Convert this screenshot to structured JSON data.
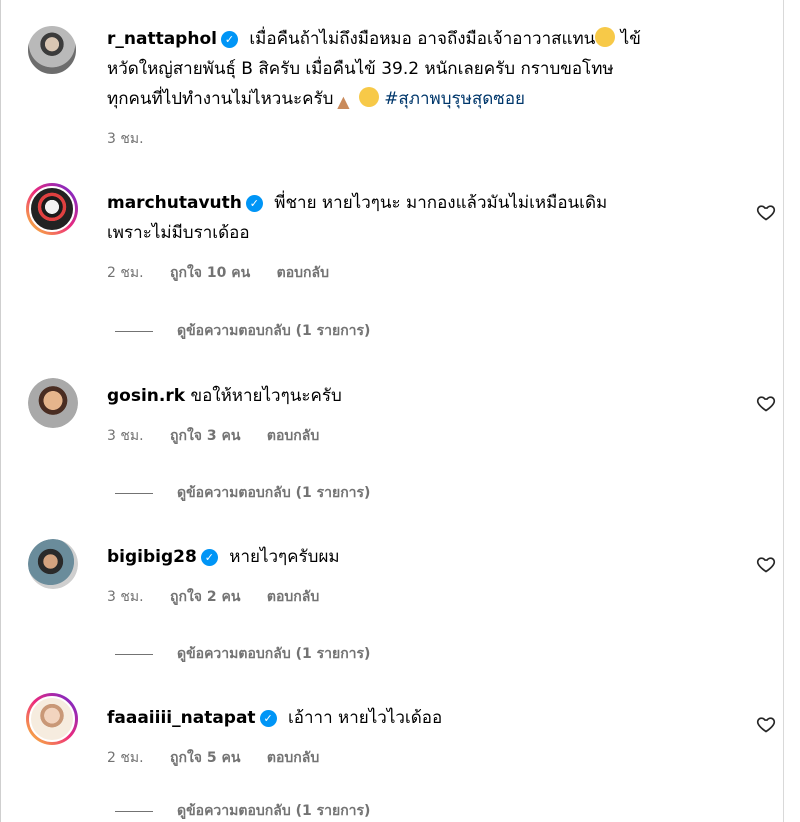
{
  "post": {
    "username": "r_nattaphol",
    "verified_icon": "verified-badge-icon",
    "caption_line1": "เมื่อคืนถ้าไม่ถึงมือหมอ อาจถึงมือเจ้าอาวาสแทน",
    "caption_line1_end": " ไข้",
    "caption_line2": "หวัดใหญ่สายพันธุ์ B สิครับ เมื่อคืนไข้ 39.2 หนักเลยครับ กราบขอโทษ",
    "caption_line3": "ทุกคนที่ไปทำงานไม่ไหวนะครับ",
    "hashtag": "#สุภาพบุรุษสุดซอย",
    "time": "3 ชม."
  },
  "comments": [
    {
      "username": "marchutavuth",
      "verified": true,
      "text_line1": "พี่ชาย หายไวๆนะ มากองแล้วมันไม่เหมือนเดิม",
      "text_line2": "เพราะไม่มีบราเด้ออ",
      "time": "2 ชม.",
      "likes": "ถูกใจ 10 คน",
      "reply_label": "ตอบกลับ",
      "view_replies": "ดูข้อความตอบกลับ (1 รายการ)"
    },
    {
      "username": "gosin.rk",
      "verified": false,
      "text_line1": "ขอให้หายไวๆนะครับ",
      "time": "3 ชม.",
      "likes": "ถูกใจ 3 คน",
      "reply_label": "ตอบกลับ",
      "view_replies": "ดูข้อความตอบกลับ (1 รายการ)"
    },
    {
      "username": "bigibig28",
      "verified": true,
      "text_line1": "หายไวๆครับผม",
      "time": "3 ชม.",
      "likes": "ถูกใจ 2 คน",
      "reply_label": "ตอบกลับ",
      "view_replies": "ดูข้อความตอบกลับ (1 รายการ)"
    },
    {
      "username": "faaaiiii_natapat",
      "verified": true,
      "text_line1": "เอ้าาา หายไวไวเด้ออ",
      "time": "2 ชม.",
      "likes": "ถูกใจ 5 คน",
      "reply_label": "ตอบกลับ",
      "view_replies": "ดูข้อความตอบกลับ (1 รายการ)"
    }
  ],
  "icons": {
    "like": "heart-outline-icon",
    "verified": "verified-badge-icon"
  },
  "colors": {
    "verified": "#0095f6",
    "hashtag": "#00376b",
    "muted": "#737373"
  }
}
